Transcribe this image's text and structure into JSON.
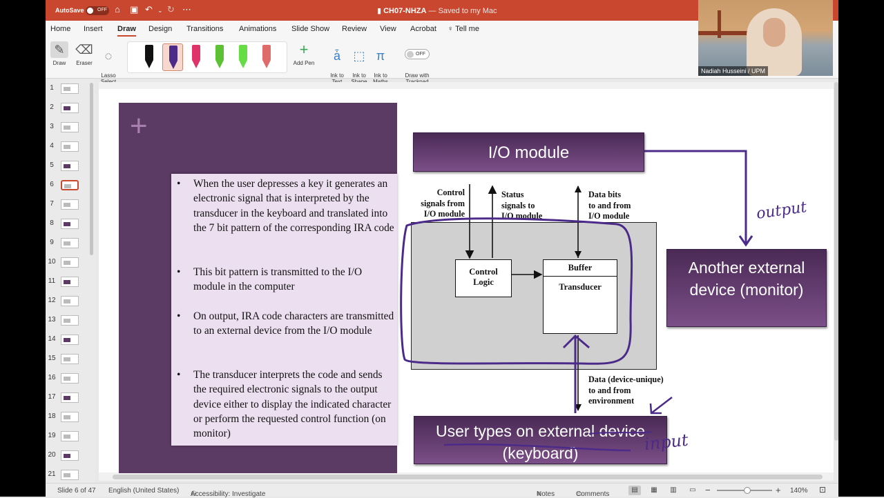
{
  "titlebar": {
    "autosave_label": "AutoSave",
    "autosave_state": "OFF",
    "doc_title": "CH07-NHZA",
    "saved_status": " — Saved to my Mac"
  },
  "ribbon": {
    "tabs": [
      "Home",
      "Insert",
      "Draw",
      "Design",
      "Transitions",
      "Animations",
      "Slide Show",
      "Review",
      "View",
      "Acrobat",
      "Tell me"
    ],
    "active_tab": "Draw",
    "draw": "Draw",
    "eraser": "Eraser",
    "lasso": "Lasso\nSelect",
    "add_pen": "Add Pen",
    "ink_to_text": "Ink to\nText",
    "ink_to_shape": "Ink to\nShape",
    "ink_to_maths": "Ink to\nMaths",
    "trackpad_state": "OFF",
    "draw_trackpad": "Draw with\nTrackpad",
    "pen_colors": [
      "#111111",
      "#4b2a8a",
      "#e0336a",
      "#5cc234",
      "#66dd44",
      "#e06b6b"
    ]
  },
  "video": {
    "name": "Nadiah Husseini / UPM"
  },
  "thumbnails": {
    "numbers": [
      "1",
      "2",
      "3",
      "4",
      "5",
      "6",
      "7",
      "8",
      "9",
      "10",
      "11",
      "12",
      "13",
      "14",
      "15",
      "16",
      "17",
      "18",
      "19",
      "20",
      "21"
    ],
    "active": "6"
  },
  "slide": {
    "bullets": [
      "When the user depresses a key it generates an electronic signal that is interpreted by the transducer in the keyboard and translated into the 7 bit pattern of the corresponding IRA code",
      "This bit pattern is transmitted to the I/O module in the computer",
      "On output, IRA code characters are transmitted to an external device from the I/O module",
      "The transducer interprets the code and sends the required electronic signals to the output device either to display the indicated character or perform the requested control function (on monitor)"
    ],
    "io_module": "I/O module",
    "monitor_box": "Another external device (monitor)",
    "keyboard_box": "User types on external device (keyboard)",
    "control_signals": "Control\nsignals from\nI/O module",
    "status_signals": "Status\nsignals to\nI/O module",
    "data_bits": "Data bits\nto and from\nI/O module",
    "control_logic": "Control\nLogic",
    "buffer": "Buffer",
    "transducer": "Transducer",
    "data_device": "Data (device-unique)\nto and from\nenvironment",
    "ink_output": "output",
    "ink_input": "input",
    "accent_color": "#5b3a63",
    "ink_color": "#4b2a8a"
  },
  "status": {
    "slide_of": "Slide 6 of 47",
    "language": "English (United States)",
    "accessibility": "Accessibility: Investigate",
    "notes": "Notes",
    "comments": "Comments",
    "zoom": "140%"
  }
}
